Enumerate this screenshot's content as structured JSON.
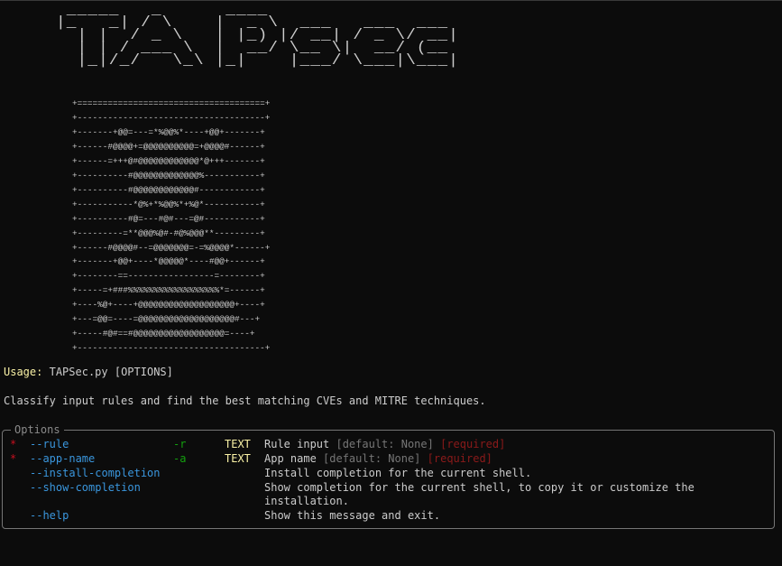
{
  "logo": {
    "ascii_lines": [
      " _____   _      ____              ",
      "|_   _| / \\    |  _ \\  ___   ___  ___ ",
      "  | |  / _ \\   | |_) |/ __| / _ \\/ __|",
      "  | | / ___ \\  |  __/ \\__ \\|  __/ (__ ",
      "  |_|/_/   \\_\\ |_|    |___/ \\___|\\___|"
    ]
  },
  "art": {
    "ascii_lines": [
      "+=====================================+",
      "+-------------------------------------+",
      "+-------+@@=---=*%@@%*----+@@+-------+",
      "+------#@@@@+=@@@@@@@@@@=+@@@@#------+",
      "+------=+++@#@@@@@@@@@@@@*@+++-------+",
      "+----------#@@@@@@@@@@@@@%-----------+",
      "+----------#@@@@@@@@@@@@#------------+",
      "+-----------*@%+*%@@%*+%@*-----------+",
      "+----------#@=---#@#---=@#-----------+",
      "+---------=**@@@%@#-#@%@@@**---------+",
      "+------#@@@@#--=@@@@@@@=-=%@@@@*------+",
      "+-------+@@+----*@@@@@*----#@@+------+",
      "+--------==-----------------=--------+",
      "+-----=+###%%%%%%%%%%%%%%%%%%*=------+",
      "+----%@+----+@@@@@@@@@@@@@@@@@@@+----+",
      "+---=@@=----=@@@@@@@@@@@@@@@@@@@#---+",
      "+-----#@#==#@@@@@@@@@@@@@@@@@@=----+",
      "+-------------------------------------+"
    ]
  },
  "usage": {
    "label": "Usage:",
    "text": "TAPSec.py [OPTIONS]"
  },
  "description": "Classify input rules and find the best matching CVEs and MITRE techniques.",
  "options_panel": {
    "title": "Options",
    "rows": [
      {
        "star": "*",
        "long": "--rule",
        "short": "-r",
        "type": "TEXT",
        "help": "Rule input",
        "default": "[default: None]",
        "required": "[required]"
      },
      {
        "star": "*",
        "long": "--app-name",
        "short": "-a",
        "type": "TEXT",
        "help": "App name",
        "default": "[default: None]",
        "required": "[required]"
      },
      {
        "long": "--install-completion",
        "help": "Install completion for the current shell."
      },
      {
        "long": "--show-completion",
        "help": "Show completion for the current shell, to copy it or customize the",
        "help_cont": "installation."
      },
      {
        "long": "--help",
        "help": "Show this message and exit."
      }
    ]
  },
  "colors": {
    "background": "#0c0c0c",
    "text": "#cccccc",
    "usage_label": "#f9f1a5",
    "option_long": "#3a96dd",
    "option_short": "#13a10e",
    "type": "#f9f1a5",
    "required_star": "#c50f1f",
    "required_tag": "#8b1a1a",
    "dim": "#767676"
  }
}
